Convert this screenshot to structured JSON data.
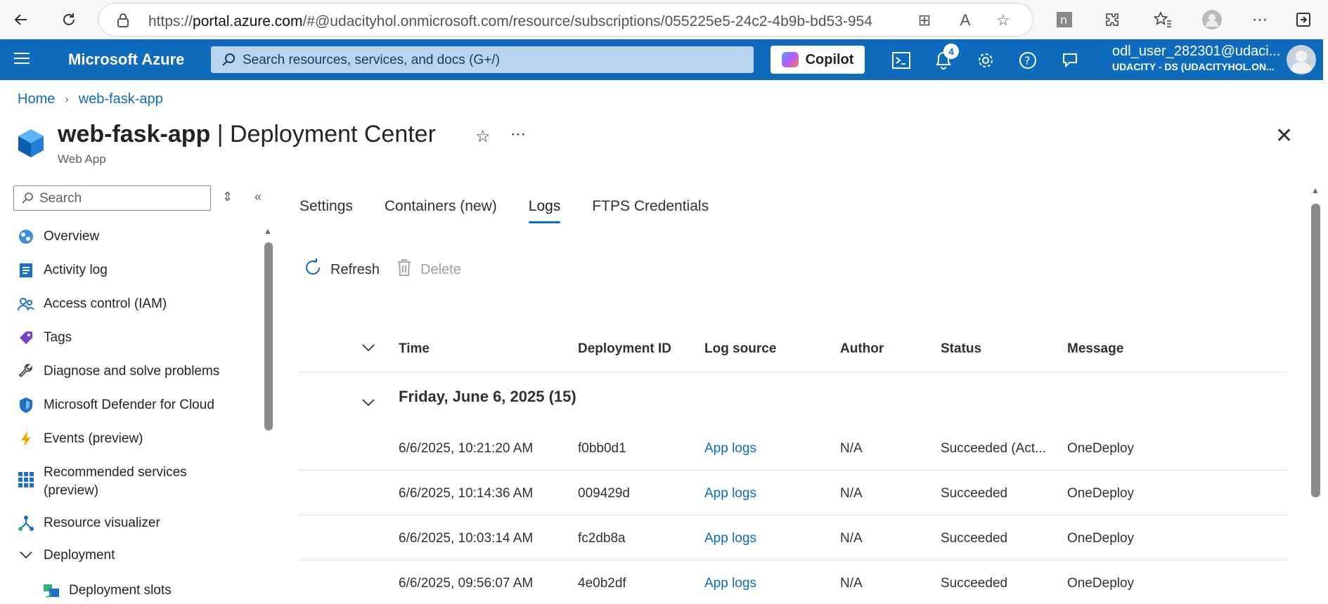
{
  "browser": {
    "url_prefix": "https://",
    "url_domain": "portal.azure.com",
    "url_rest": "/#@udacityhol.onmicrosoft.com/resource/subscriptions/055225e5-24c2-4b9b-bd53-954..."
  },
  "header": {
    "brand": "Microsoft Azure",
    "search_placeholder": "Search resources, services, and docs (G+/)",
    "copilot_label": "Copilot",
    "notification_count": "4",
    "user_name": "odl_user_282301@udaci...",
    "user_tenant": "UDACITY - DS (UDACITYHOL.ON..."
  },
  "breadcrumb": {
    "home": "Home",
    "resource": "web-fask-app"
  },
  "page": {
    "resource_name": "web-fask-app",
    "separator": " | ",
    "blade_name": "Deployment Center",
    "subtitle": "Web App"
  },
  "sidebar": {
    "search_placeholder": "Search",
    "items": [
      {
        "label": "Overview",
        "icon": "globe-icon"
      },
      {
        "label": "Activity log",
        "icon": "activity-log-icon"
      },
      {
        "label": "Access control (IAM)",
        "icon": "people-icon"
      },
      {
        "label": "Tags",
        "icon": "tag-icon"
      },
      {
        "label": "Diagnose and solve problems",
        "icon": "wrench-icon"
      },
      {
        "label": "Microsoft Defender for Cloud",
        "icon": "shield-icon"
      },
      {
        "label": "Events (preview)",
        "icon": "lightning-icon"
      },
      {
        "label": "Recommended services (preview)",
        "icon": "grid-icon"
      },
      {
        "label": "Resource visualizer",
        "icon": "network-icon"
      },
      {
        "label": "Deployment",
        "icon": "chevron-down-icon"
      },
      {
        "label": "Deployment slots",
        "icon": "slots-icon"
      }
    ]
  },
  "tabs": [
    "Settings",
    "Containers (new)",
    "Logs",
    "FTPS Credentials"
  ],
  "active_tab": "Logs",
  "toolbar": {
    "refresh_label": "Refresh",
    "delete_label": "Delete"
  },
  "table": {
    "columns": [
      "Time",
      "Deployment ID",
      "Log source",
      "Author",
      "Status",
      "Message"
    ],
    "group_label": "Friday, June 6, 2025 (15)",
    "rows": [
      {
        "time": "6/6/2025, 10:21:20 AM",
        "id": "f0bb0d1",
        "source": "App logs",
        "author": "N/A",
        "status": "Succeeded (Act...",
        "message": "OneDeploy"
      },
      {
        "time": "6/6/2025, 10:14:36 AM",
        "id": "009429d",
        "source": "App logs",
        "author": "N/A",
        "status": "Succeeded",
        "message": "OneDeploy"
      },
      {
        "time": "6/6/2025, 10:03:14 AM",
        "id": "fc2db8a",
        "source": "App logs",
        "author": "N/A",
        "status": "Succeeded",
        "message": "OneDeploy"
      },
      {
        "time": "6/6/2025, 09:56:07 AM",
        "id": "4e0b2df",
        "source": "App logs",
        "author": "N/A",
        "status": "Succeeded",
        "message": "OneDeploy"
      }
    ]
  },
  "colors": {
    "azure_blue": "#0f6cbd",
    "link": "#0f6cbd"
  }
}
